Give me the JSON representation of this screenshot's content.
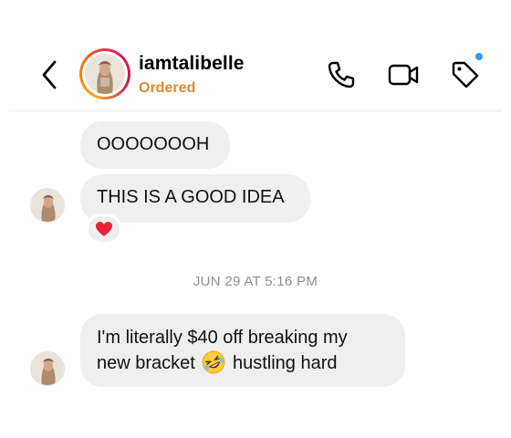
{
  "header": {
    "username": "iamtalibelle",
    "status": "Ordered",
    "icons": [
      "back-chevron-icon",
      "phone-icon",
      "video-camera-icon",
      "tag-icon"
    ],
    "colors": {
      "status": "#e0892e",
      "notification_dot": "#3897f0"
    }
  },
  "messages": [
    {
      "text": "OOOOOOOH"
    },
    {
      "text": "THIS IS A GOOD IDEA",
      "reaction": "heart"
    }
  ],
  "timestamp": "JUN 29 AT 5:16 PM",
  "last_message": {
    "line1": "I'm literally $40 off breaking my",
    "line2_before": "new bracket",
    "emoji": "rolling-on-floor-laughing",
    "line2_after": "hustling hard"
  },
  "colors": {
    "bubble": "#efefef",
    "timestamp": "#8e8e8e"
  }
}
